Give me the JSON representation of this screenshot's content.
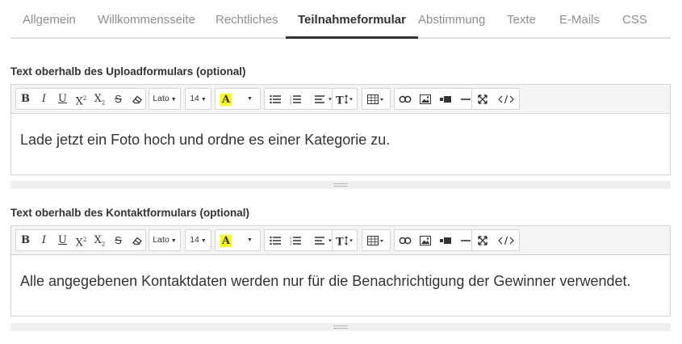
{
  "tabs": [
    {
      "label": "Allgemein",
      "active": false
    },
    {
      "label": "Willkommensseite",
      "active": false
    },
    {
      "label": "Rechtliches",
      "active": false
    },
    {
      "label": "Teilnahmeformular",
      "active": true
    },
    {
      "label": "Abstimmung",
      "active": false
    },
    {
      "label": "Texte",
      "active": false
    },
    {
      "label": "E-Mails",
      "active": false
    },
    {
      "label": "CSS",
      "active": false
    }
  ],
  "toolbar": {
    "bold": "B",
    "italic": "I",
    "underline": "U",
    "superscript": "X",
    "subscript": "X",
    "strikethrough": "S",
    "font_family": "Lato",
    "font_size": "14",
    "color_letter": "A",
    "highlight_color": "#ffff00",
    "icons": [
      "eraser-icon",
      "unordered-list-icon",
      "ordered-list-icon",
      "align-icon",
      "text-height-icon",
      "table-icon",
      "link-icon",
      "image-icon",
      "video-icon",
      "horizontal-rule-icon",
      "fullscreen-icon",
      "code-view-icon"
    ]
  },
  "editors": [
    {
      "label": "Text oberhalb des Uploadformulars (optional)",
      "content": "Lade jetzt ein Foto hoch und ordne es einer Kategorie zu."
    },
    {
      "label": "Text oberhalb des Kontaktformulars (optional)",
      "content": "Alle angegebenen Kontaktdaten werden nur für die Benachrichtigung der Gewinner verwendet."
    }
  ]
}
